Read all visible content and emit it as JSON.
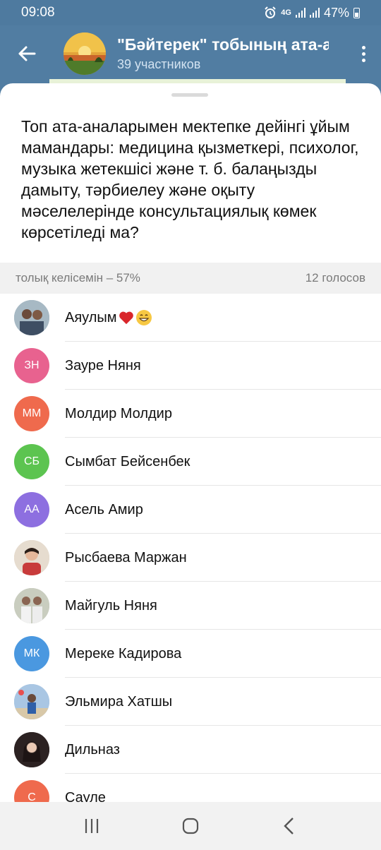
{
  "status": {
    "time": "09:08",
    "network": "4G",
    "battery": "47%"
  },
  "chat": {
    "title": "\"Бәйтерек\" тобының ата-а",
    "subtitle": "39 участников"
  },
  "poll": {
    "question": "Топ ата-аналарымен мектепке дейінгі ұйым мамандары: медицина қызметкері, психолог, музыка жетекшісі және т. б. балаңызды дамыту, тәрбиелеу және оқыту мәселелерінде консультациялық көмек көрсетіледі ма?",
    "option_header": "толық келісемін – 57%",
    "votes": "12 голосов"
  },
  "voters": [
    {
      "name": "Аяулым",
      "initials": "",
      "color": "#8FA8B8",
      "emoji": [
        "heart",
        "grin"
      ]
    },
    {
      "name": "Зауре Няня",
      "initials": "ЗН",
      "color": "#E8628F"
    },
    {
      "name": "Молдир Молдир",
      "initials": "ММ",
      "color": "#EF6A4D"
    },
    {
      "name": "Сымбат Бейсенбек",
      "initials": "СБ",
      "color": "#5CC450"
    },
    {
      "name": "Асель Амир",
      "initials": "АА",
      "color": "#8D6FE0"
    },
    {
      "name": "Рысбаева Маржан",
      "initials": "",
      "color": "#D9C9B5"
    },
    {
      "name": "Майгуль Няня",
      "initials": "",
      "color": "#B8BFAF"
    },
    {
      "name": "Мереке Кадирова",
      "initials": "МК",
      "color": "#4A98E0"
    },
    {
      "name": "Эльмира Хатшы",
      "initials": "",
      "color": "#9CB8D8"
    },
    {
      "name": "Дильназ",
      "initials": "",
      "color": "#3A2A2A"
    },
    {
      "name": "Сауле",
      "initials": "С",
      "color": "#EF6A4D"
    }
  ]
}
